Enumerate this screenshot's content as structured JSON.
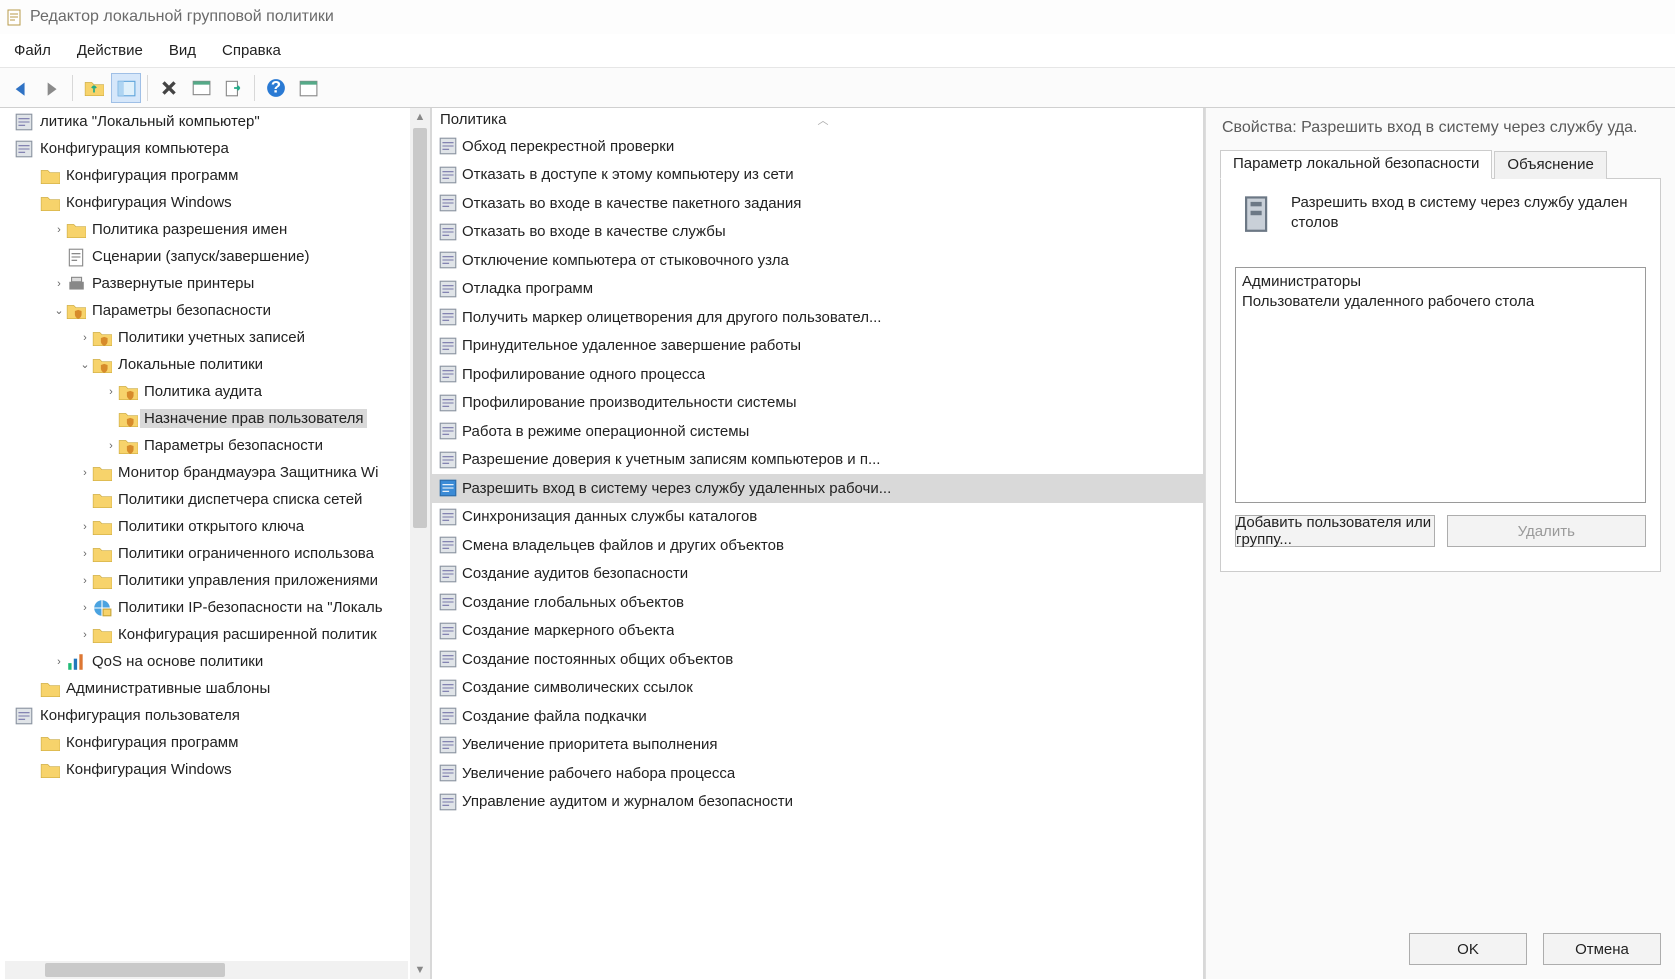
{
  "titlebar": {
    "title": "Редактор локальной групповой политики"
  },
  "menu": {
    "file": "Файл",
    "action": "Действие",
    "view": "Вид",
    "help": "Справка"
  },
  "tree": {
    "items": [
      {
        "d": 0,
        "exp": "",
        "icon": "root",
        "label": "литика \"Локальный компьютер\""
      },
      {
        "d": 0,
        "exp": "",
        "icon": "comp",
        "label": "Конфигурация компьютера"
      },
      {
        "d": 1,
        "exp": "",
        "icon": "folder",
        "label": "Конфигурация программ"
      },
      {
        "d": 1,
        "exp": "",
        "icon": "folder",
        "label": "Конфигурация Windows"
      },
      {
        "d": 2,
        "exp": ">",
        "icon": "folder",
        "label": "Политика разрешения имен"
      },
      {
        "d": 2,
        "exp": "",
        "icon": "script",
        "label": "Сценарии (запуск/завершение)"
      },
      {
        "d": 2,
        "exp": ">",
        "icon": "printer",
        "label": "Развернутые принтеры"
      },
      {
        "d": 2,
        "exp": "v",
        "icon": "secfold",
        "label": "Параметры безопасности"
      },
      {
        "d": 3,
        "exp": ">",
        "icon": "secfold",
        "label": "Политики учетных записей"
      },
      {
        "d": 3,
        "exp": "v",
        "icon": "secfold",
        "label": "Локальные политики"
      },
      {
        "d": 4,
        "exp": ">",
        "icon": "secfold",
        "label": "Политика аудита"
      },
      {
        "d": 4,
        "exp": "",
        "icon": "secfold",
        "label": "Назначение прав пользователя",
        "selected": true
      },
      {
        "d": 4,
        "exp": ">",
        "icon": "secfold",
        "label": "Параметры безопасности"
      },
      {
        "d": 3,
        "exp": ">",
        "icon": "folder",
        "label": "Монитор брандмауэра Защитника Wi"
      },
      {
        "d": 3,
        "exp": "",
        "icon": "folder",
        "label": "Политики диспетчера списка сетей"
      },
      {
        "d": 3,
        "exp": ">",
        "icon": "folder",
        "label": "Политики открытого ключа"
      },
      {
        "d": 3,
        "exp": ">",
        "icon": "folder",
        "label": "Политики ограниченного использова"
      },
      {
        "d": 3,
        "exp": ">",
        "icon": "folder",
        "label": "Политики управления приложениями"
      },
      {
        "d": 3,
        "exp": ">",
        "icon": "ipsec",
        "label": "Политики IP-безопасности на \"Локаль"
      },
      {
        "d": 3,
        "exp": ">",
        "icon": "folder",
        "label": "Конфигурация расширенной политик"
      },
      {
        "d": 2,
        "exp": ">",
        "icon": "qos",
        "label": "QoS на основе политики"
      },
      {
        "d": 1,
        "exp": "",
        "icon": "folder",
        "label": "Административные шаблоны"
      },
      {
        "d": 0,
        "exp": "",
        "icon": "user",
        "label": "Конфигурация пользователя"
      },
      {
        "d": 1,
        "exp": "",
        "icon": "folder",
        "label": "Конфигурация программ"
      },
      {
        "d": 1,
        "exp": "",
        "icon": "folder",
        "label": "Конфигурация Windows"
      }
    ]
  },
  "list": {
    "header": "Политика",
    "items": [
      {
        "label": "Обход перекрестной проверки"
      },
      {
        "label": "Отказать в доступе к этому компьютеру из сети"
      },
      {
        "label": "Отказать во входе в качестве пакетного задания"
      },
      {
        "label": "Отказать во входе в качестве службы"
      },
      {
        "label": "Отключение компьютера от стыковочного узла"
      },
      {
        "label": "Отладка программ"
      },
      {
        "label": "Получить маркер олицетворения для другого пользовател..."
      },
      {
        "label": "Принудительное удаленное завершение работы"
      },
      {
        "label": "Профилирование одного процесса"
      },
      {
        "label": "Профилирование производительности системы"
      },
      {
        "label": "Работа в режиме операционной системы"
      },
      {
        "label": "Разрешение доверия к учетным записям компьютеров и п..."
      },
      {
        "label": "Разрешить вход в систему через службу удаленных рабочи...",
        "selected": true
      },
      {
        "label": "Синхронизация данных службы каталогов"
      },
      {
        "label": "Смена владельцев файлов и других объектов"
      },
      {
        "label": "Создание аудитов безопасности"
      },
      {
        "label": "Создание глобальных объектов"
      },
      {
        "label": "Создание маркерного объекта"
      },
      {
        "label": "Создание постоянных общих объектов"
      },
      {
        "label": "Создание символических ссылок"
      },
      {
        "label": "Создание файла подкачки"
      },
      {
        "label": "Увеличение приоритета выполнения"
      },
      {
        "label": "Увеличение рабочего набора процесса"
      },
      {
        "label": "Управление аудитом и журналом безопасности"
      }
    ]
  },
  "dialog": {
    "title": "Свойства: Разрешить вход в систему через службу уда.",
    "tab_local": "Параметр локальной безопасности",
    "tab_explain": "Объяснение",
    "policy_name": "Разрешить вход в систему через службу удален столов",
    "users": [
      "Администраторы",
      "Пользователи удаленного рабочего стола"
    ],
    "add_btn": "Добавить пользователя или группу...",
    "del_btn": "Удалить",
    "ok": "OK",
    "cancel": "Отмена"
  }
}
